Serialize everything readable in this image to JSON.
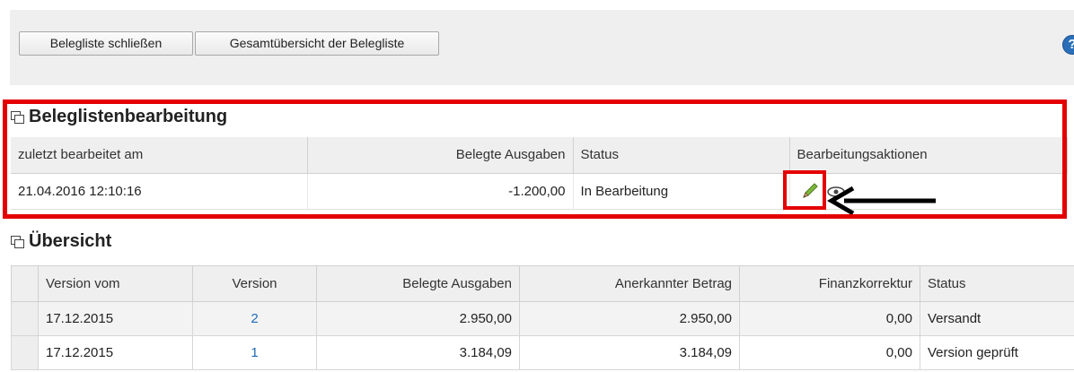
{
  "toolbar": {
    "close_button": "Belegliste schließen",
    "overview_button": "Gesamtübersicht der Belegliste",
    "help_icon": "help-icon"
  },
  "edit_section": {
    "title": "Beleglistenbearbeitung",
    "columns": [
      "zuletzt bearbeitet am",
      "Belegte Ausgaben",
      "Status",
      "Bearbeitungsaktionen"
    ],
    "row": {
      "edited_at": "21.04.2016 12:10:16",
      "expenses": "-1.200,00",
      "status": "In Bearbeitung"
    },
    "action_icons": [
      "pencil-icon",
      "eye-icon"
    ]
  },
  "overview_section": {
    "title": "Übersicht",
    "columns": [
      "Version vom",
      "Version",
      "Belegte Ausgaben",
      "Anerkannter Betrag",
      "Finanzkorrektur",
      "Status"
    ],
    "rows": [
      {
        "date": "17.12.2015",
        "version": "2",
        "expenses": "2.950,00",
        "recognized": "2.950,00",
        "correction": "0,00",
        "status": "Versandt"
      },
      {
        "date": "17.12.2015",
        "version": "1",
        "expenses": "3.184,09",
        "recognized": "3.184,09",
        "correction": "0,00",
        "status": "Version geprüft"
      }
    ]
  },
  "colors": {
    "highlight": "#e40000",
    "link": "#1f6cb8",
    "header_bg": "#efefef"
  }
}
